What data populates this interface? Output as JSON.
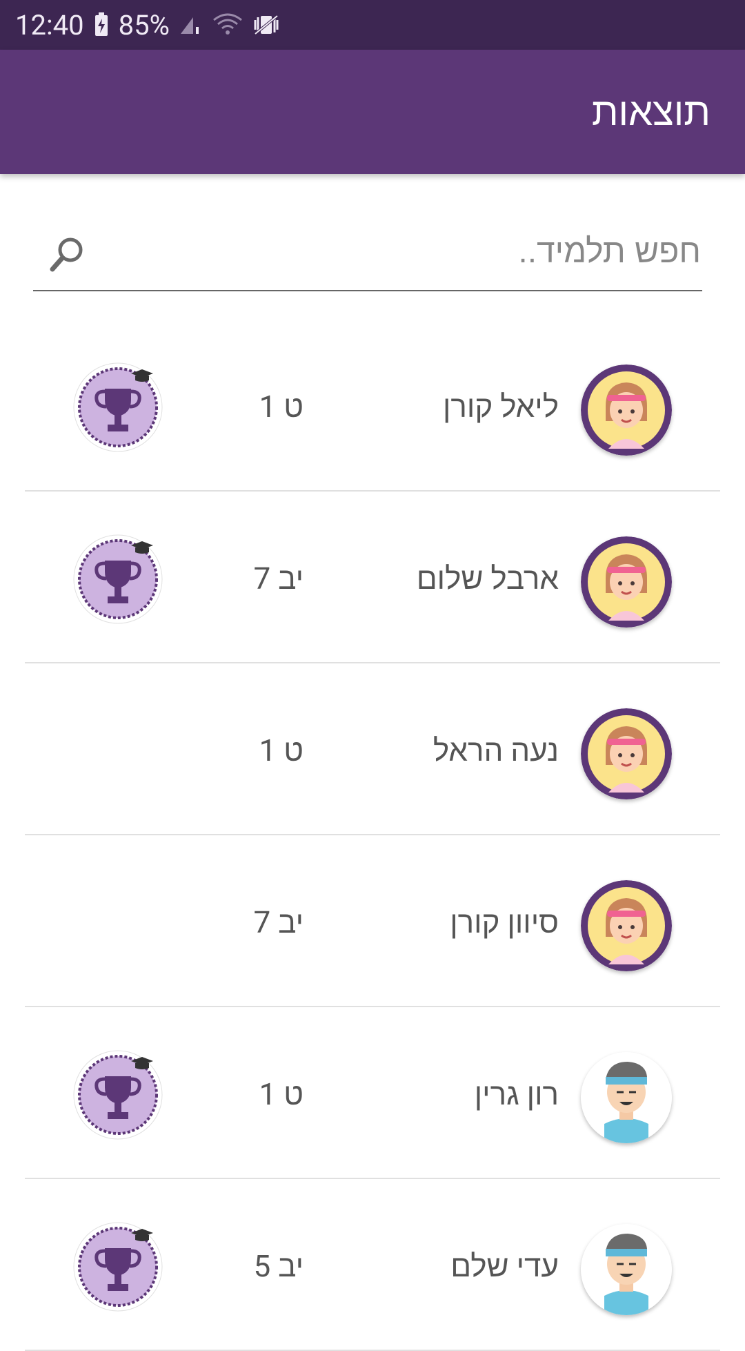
{
  "status_bar": {
    "time": "12:40",
    "battery": "85%",
    "icons": [
      "battery-charging-icon",
      "signal-icon",
      "wifi-icon",
      "vibrate-icon"
    ]
  },
  "app_bar": {
    "title": "תוצאות"
  },
  "search": {
    "placeholder": "חפש תלמיד..",
    "value": ""
  },
  "students": [
    {
      "name": "ליאל קורן",
      "grade": "ט 1",
      "avatar": "girl",
      "trophy": true
    },
    {
      "name": "ארבל שלום",
      "grade": "יב 7",
      "avatar": "girl",
      "trophy": true
    },
    {
      "name": "נעה הראל",
      "grade": "ט 1",
      "avatar": "girl",
      "trophy": false
    },
    {
      "name": "סיוון קורן",
      "grade": "יב 7",
      "avatar": "girl",
      "trophy": false
    },
    {
      "name": "רון גרין",
      "grade": "ט 1",
      "avatar": "boy",
      "trophy": true
    },
    {
      "name": "עדי שלם",
      "grade": "יב 5",
      "avatar": "boy",
      "trophy": true
    }
  ],
  "colors": {
    "status_bar": "#3d2652",
    "app_bar": "#5c3777",
    "badge_fill": "#cdb3e0",
    "badge_border": "#5c3777"
  }
}
